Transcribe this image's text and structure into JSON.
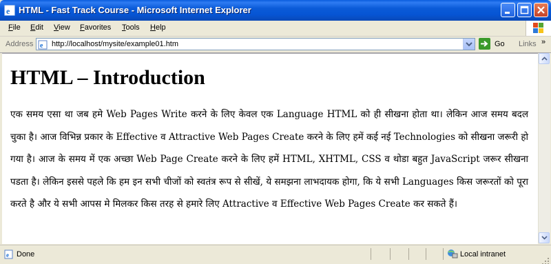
{
  "window": {
    "title": "HTML - Fast Track Course - Microsoft Internet Explorer"
  },
  "menu": {
    "items": [
      "File",
      "Edit",
      "View",
      "Favorites",
      "Tools",
      "Help"
    ]
  },
  "address_bar": {
    "label": "Address",
    "url": "http://localhost/mysite/example01.htm",
    "go_label": "Go",
    "links_label": "Links",
    "links_chevron": "»"
  },
  "page": {
    "heading": "HTML – Introduction",
    "paragraph": "एक समय एसा था जब हमे Web Pages Write करने के लिए केवल एक Language HTML को ही सीखना होता था। लेकिन आज समय बदल चुका है। आज विभिन्न प्रकार के Effective व Attractive Web Pages Create करने के लिए हमें कई नई Technologies को सीखना जरूरी हो गया है। आज के समय में एक अच्छा Web Page Create करने के लिए हमें HTML, XHTML, CSS व थोडा बहुत JavaScript जरूर सीखना पडता है। लेकिन इससे पहले कि हम इन सभी चीजों को स्वतंत्र रूप से सीखें, ये समझना लाभदायक होगा, कि ये सभी Languages किस जरूरतों को पूरा करते है और ये सभी आपस मे मिलकर किस तरह से हमारे लिए Attractive व Effective Web Pages Create कर सकते हैं।"
  },
  "status_bar": {
    "status": "Done",
    "zone": "Local intranet"
  },
  "icons": {
    "app": "ie-page-icon",
    "minimize": "minimize-icon",
    "maximize": "maximize-icon",
    "close": "close-icon",
    "windows_logo": "windows-logo-icon",
    "go": "go-arrow-icon",
    "zone": "intranet-zone-icon"
  },
  "colors": {
    "titlebar": "#0655d4",
    "chrome": "#ece9d8",
    "close_button": "#c4432a"
  }
}
